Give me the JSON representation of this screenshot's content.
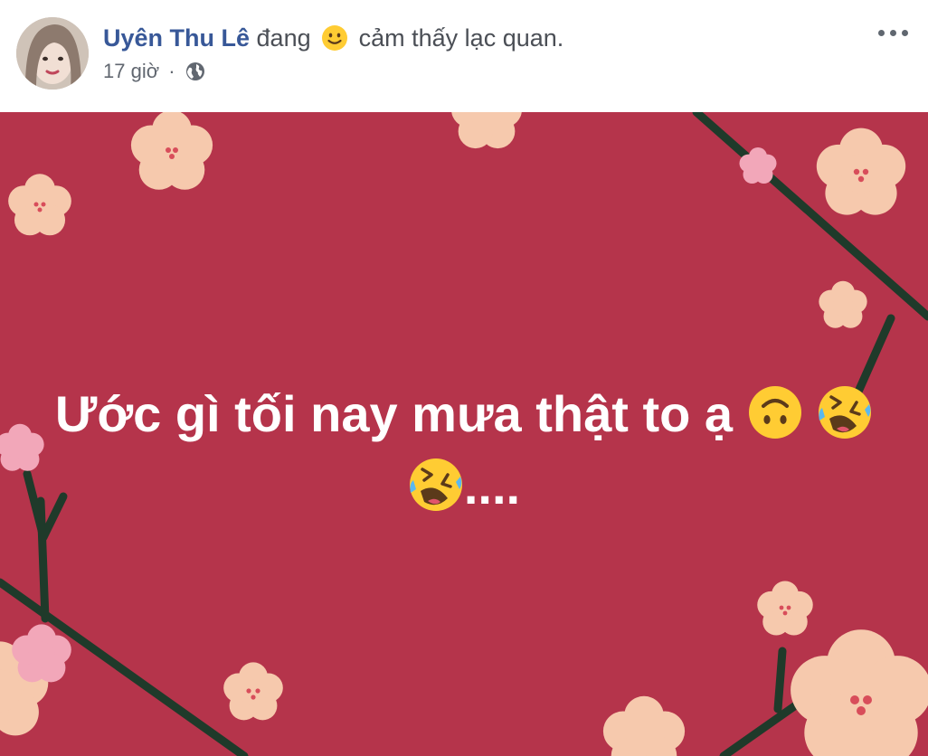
{
  "author": {
    "name": "Uyên Thu Lê",
    "activity_prefix": "đang",
    "feeling_icon": "smiling-face-emoji",
    "feeling_text": "cảm thấy lạc quan."
  },
  "meta": {
    "time": "17 giờ",
    "separator": "·",
    "privacy_icon": "globe-icon"
  },
  "post": {
    "text_line1": "Ước gì tối nay mưa thật to ạ",
    "line1_emojis": [
      "upside-down-face-emoji",
      "rolling-on-floor-laughing-emoji"
    ],
    "line2_emoji": "rolling-on-floor-laughing-emoji",
    "text_line2_suffix": "....",
    "background_color": "#b5344b"
  },
  "colors": {
    "name_link": "#385898",
    "meta_text": "#616770"
  }
}
